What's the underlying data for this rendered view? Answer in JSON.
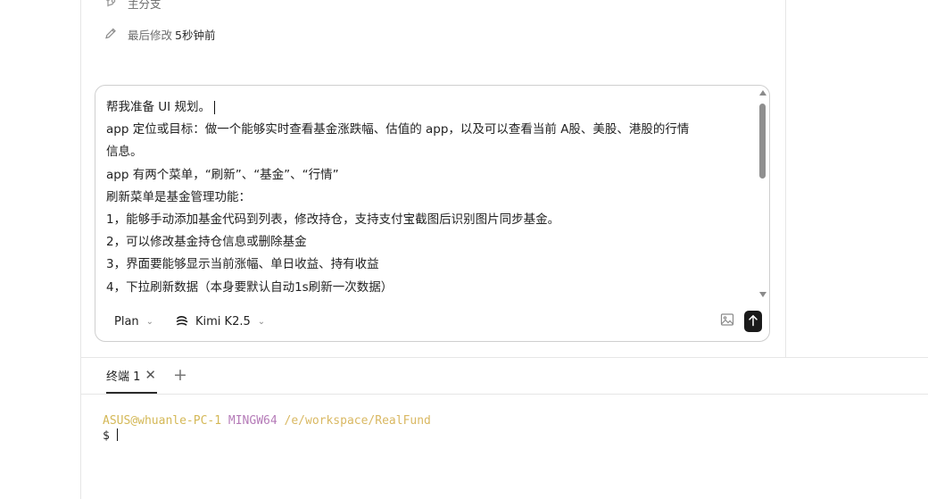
{
  "meta": {
    "branch_label": "主分支",
    "modified_label": "最后修改",
    "modified_value": "5秒钟前"
  },
  "composer": {
    "lines": [
      "帮我准备 UI 规划。",
      "app 定位或目标：做一个能够实时查看基金涨跌幅、估值的 app，以及可以查看当前 A股、美股、港股的行情",
      "信息。",
      "app 有两个菜单，“刷新”、“基金”、“行情”",
      "刷新菜单是基金管理功能：",
      "1，能够手动添加基金代码到列表，修改持仓，支持支付宝截图后识别图片同步基金。",
      "2，可以修改基金持仓信息或删除基金",
      "3，界面要能够显示当前涨幅、单日收益、持有收益",
      "4，下拉刷新数据（本身要默认自动1s刷新一次数据）"
    ],
    "mode": "Plan",
    "model": "Kimi K2.5"
  },
  "terminal": {
    "tab_label": "终端 1",
    "user_host": "ASUS@whuanle-PC-1",
    "env": "MINGW64",
    "path": "/e/workspace/RealFund",
    "prompt": "$"
  },
  "colors": {
    "terminal_user": "#d4b857",
    "terminal_env": "#b57bb8",
    "terminal_path": "#d9b862",
    "send_button": "#1a1a1a"
  },
  "icons": {
    "branch": "git-branch-icon",
    "edit": "pencil-icon",
    "model": "kimi-logo-icon",
    "image": "image-icon",
    "send": "arrow-up-icon",
    "close": "close-icon",
    "add": "plus-icon",
    "chevron": "chevron-down-icon"
  }
}
